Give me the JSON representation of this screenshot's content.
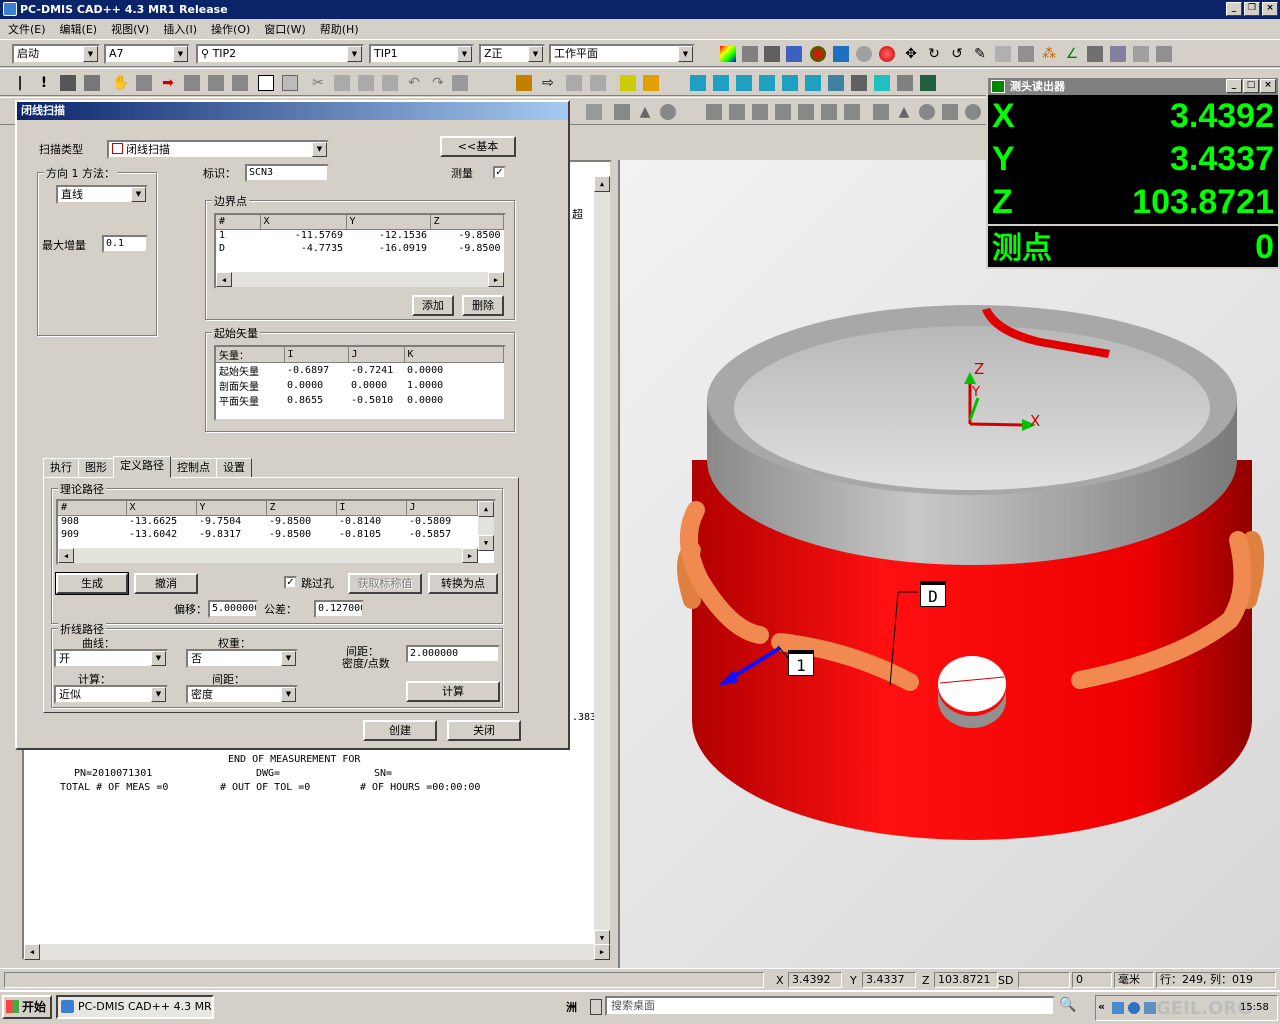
{
  "app": {
    "title": "PC-DMIS CAD++ 4.3 MR1 Release"
  },
  "menu": [
    "文件(E)",
    "编辑(E)",
    "视图(V)",
    "插入(I)",
    "操作(O)",
    "窗口(W)",
    "帮助(H)"
  ],
  "toolbar": {
    "mode": "启动",
    "probe_file": "A7",
    "tip": "TIP2",
    "tip2": "TIP1",
    "workplane_axis": "Z正",
    "workplane": "工作平面"
  },
  "readout": {
    "title": "测头读出器",
    "rows": [
      {
        "label": "X",
        "value": "3.4392"
      },
      {
        "label": "Y",
        "value": "3.4337"
      },
      {
        "label": "Z",
        "value": "103.8721"
      },
      {
        "label": "测点",
        "value": "0"
      }
    ]
  },
  "dialog": {
    "title": "闭线扫描",
    "scan_type_label": "扫描类型",
    "scan_type": "闭线扫描",
    "basic_button": "<<基本",
    "id_label": "标识：",
    "id_value": "SCN3",
    "measure_label": "测量",
    "direction_group": "方向 1 方法：",
    "direction_method": "直线",
    "max_increment_label": "最大增量",
    "max_increment": "0.1",
    "boundary": {
      "title": "边界点",
      "headers": [
        "#",
        "X",
        "Y",
        "Z"
      ],
      "rows": [
        [
          "1",
          "-11.5769",
          "-12.1536",
          "-9.8500"
        ],
        [
          "D",
          "-4.7735",
          "-16.0919",
          "-9.8500"
        ]
      ],
      "add": "添加",
      "delete": "删除"
    },
    "start_vector": {
      "title": "起始矢量",
      "headers": [
        "矢量：",
        "I",
        "J",
        "K"
      ],
      "rows": [
        [
          "起始矢量",
          "-0.6897",
          "-0.7241",
          "0.0000"
        ],
        [
          "剖面矢量",
          "0.0000",
          "0.0000",
          "1.0000"
        ],
        [
          "平面矢量",
          "0.8655",
          "-0.5010",
          "0.0000"
        ]
      ]
    },
    "tabs": [
      "执行",
      "图形",
      "定义路径",
      "控制点",
      "设置"
    ],
    "theory_path": {
      "title": "理论路径",
      "headers": [
        "#",
        "X",
        "Y",
        "Z",
        "I",
        "J"
      ],
      "rows": [
        [
          "908",
          "-13.6625",
          "-9.7504",
          "-9.8500",
          "-0.8140",
          "-0.5809"
        ],
        [
          "909",
          "-13.6042",
          "-9.8317",
          "-9.8500",
          "-0.8105",
          "-0.5857"
        ]
      ],
      "generate": "生成",
      "undo": "撤消",
      "skip_holes": "跳过孔",
      "get_nominal": "获取标称值",
      "convert_to_points": "转换为点",
      "offset_label": "偏移：",
      "offset": "5.000000",
      "tolerance_label": "公差：",
      "tolerance": "0.127000"
    },
    "polyline": {
      "title": "折线路径",
      "curve_label": "曲线：",
      "curve": "开",
      "weight_label": "权重：",
      "weight": "否",
      "spacing_label1": "间距：",
      "spacing_label2": "密度/点数",
      "spacing_value": "2.000000",
      "compute_label": "计算：",
      "compute": "近似",
      "spacing2_label": "间距：",
      "spacing2": "密度",
      "calc_button": "计算"
    },
    "create": "创建",
    "close": "关闭"
  },
  "report": {
    "side_char": "超",
    "side_value": ".383",
    "line1": "END OF MEASUREMENT FOR",
    "pn": "PN=2010071301",
    "dwg": "DWG=",
    "sn": "SN=",
    "total": "TOTAL # OF MEAS =0",
    "outtol": "# OUT OF TOL =0",
    "hours": "# OF HOURS =00:00:00"
  },
  "cad": {
    "axis_z": "Z",
    "axis_y": "Y",
    "axis_x": "X",
    "marker_d": "D",
    "marker_1": "1",
    "body_color": "#ff0000",
    "path_color": "#f08040"
  },
  "status": {
    "x_label": "X",
    "x": "3.4392",
    "y_label": "Y",
    "y": "3.4337",
    "z_label": "Z",
    "z": "103.8721",
    "sd": "SD",
    "count": "0",
    "unit": "毫米",
    "rowcol": "行：249, 列：019"
  },
  "taskbar": {
    "start": "开始",
    "task": "PC-DMIS CAD++ 4.3 MR...",
    "search": "搜索桌面",
    "time": "15:58",
    "watermark": "GEIL.ORG"
  }
}
